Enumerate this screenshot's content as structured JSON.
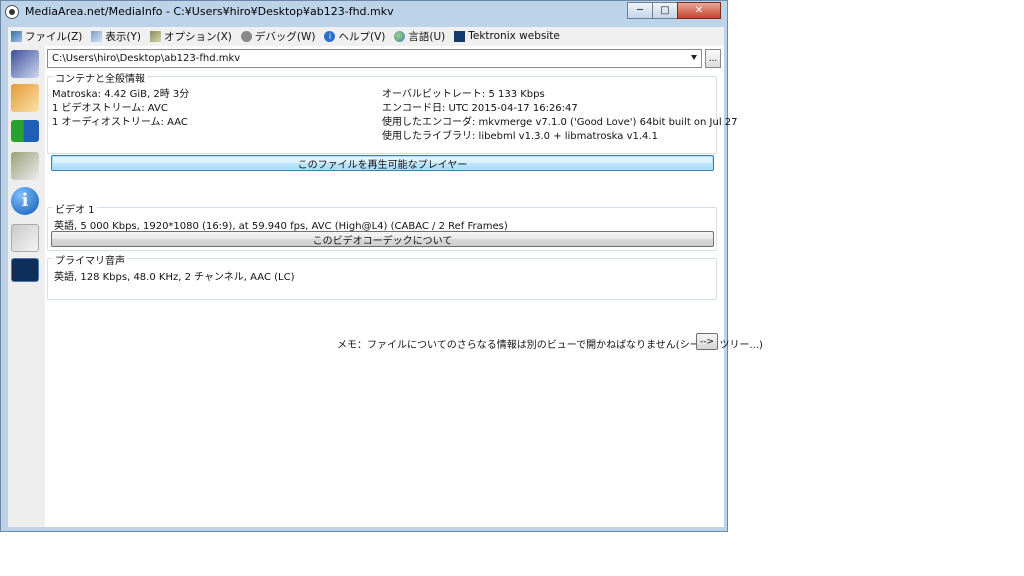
{
  "window": {
    "title": "MediaArea.net/MediaInfo - C:¥Users¥hiro¥Desktop¥ab123-fhd.mkv",
    "minimize": "─",
    "maximize": "□",
    "close": "✕"
  },
  "menu": [
    {
      "label": "ファイル(Z)",
      "icon": "file-icon"
    },
    {
      "label": "表示(Y)",
      "icon": "view-icon"
    },
    {
      "label": "オプション(X)",
      "icon": "options-icon"
    },
    {
      "label": "デバッグ(W)",
      "icon": "debug-icon"
    },
    {
      "label": "ヘルプ(V)",
      "icon": "help-icon"
    },
    {
      "label": "言語(U)",
      "icon": "language-icon"
    },
    {
      "label": "Tektronix website",
      "icon": "tektronix-icon"
    }
  ],
  "sidebar": [
    "open-file-icon",
    "open-folder-icon",
    "export-info-icon",
    "options-tools-icon",
    "about-icon",
    "copy-clipboard-icon",
    "tektronix-icon"
  ],
  "path": {
    "value": "C:\\Users\\hiro\\Desktop\\ab123-fhd.mkv",
    "browse_label": "..."
  },
  "general": {
    "title": "コンテナと全般情報",
    "left": [
      "Matroska: 4.42 GiB, 2時 3分",
      "1 ビデオストリーム: AVC",
      "1 オーディオストリーム: AAC"
    ],
    "right": [
      "オーバルビットレート: 5 133 Kbps",
      "エンコード日: UTC 2015-04-17 16:26:47",
      "使用したエンコーダ: mkvmerge v7.1.0 ('Good Love') 64bit built on Jul 27",
      "使用したライブラリ: libebml v1.3.0 + libmatroska v1.4.1"
    ],
    "button": "このファイルを再生可能なプレイヤー"
  },
  "video": {
    "title": "ビデオ 1",
    "line": "英語, 5 000 Kbps, 1920*1080 (16:9), at 59.940 fps, AVC (High@L4) (CABAC / 2 Ref Frames)",
    "button": "このビデオコーデックについて"
  },
  "audio": {
    "title": "プライマリ音声",
    "line": "英語, 128 Kbps, 48.0 KHz, 2 チャンネル, AAC (LC)"
  },
  "note": {
    "text": "メモ：ファイルについてのさらなる情報は別のビューで開かねばなりません(シート、ツリー...)",
    "button": "-->"
  }
}
